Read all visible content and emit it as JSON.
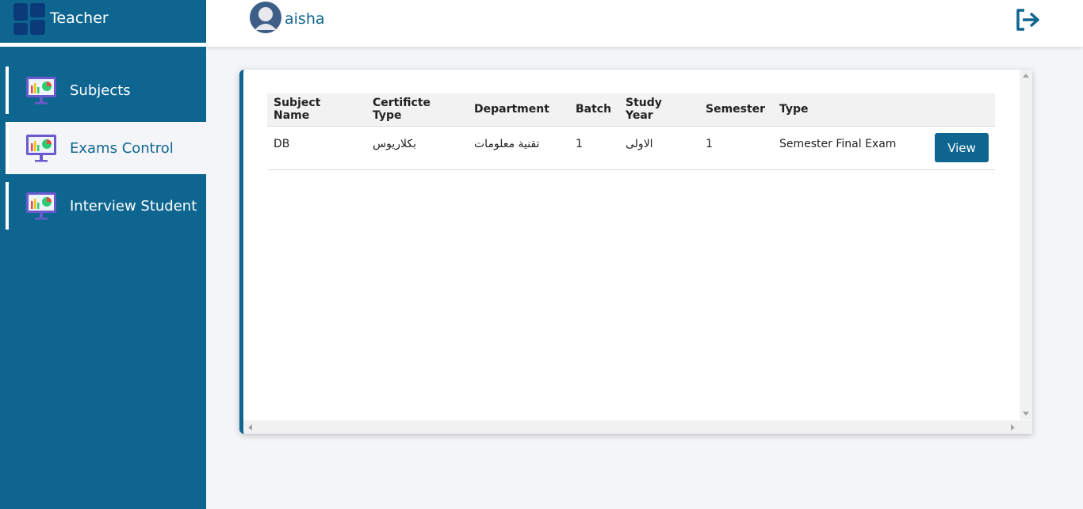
{
  "sidebar": {
    "brand_title": "Teacher",
    "items": [
      {
        "label": "Subjects",
        "icon": "presentation-chart-icon",
        "active": false
      },
      {
        "label": "Exams Control",
        "icon": "presentation-chart-icon",
        "active": true
      },
      {
        "label": "Interview Student",
        "icon": "presentation-chart-icon",
        "active": false
      }
    ]
  },
  "header": {
    "username": "aisha",
    "avatar_icon": "user-avatar-icon",
    "logout_icon": "logout-icon"
  },
  "table": {
    "columns": [
      "Subject Name",
      "Certificte Type",
      "Department",
      "Batch",
      "Study Year",
      "Semester",
      "Type",
      ""
    ],
    "rows": [
      {
        "subject_name": "DB",
        "certificate_type": "بكلاريوس",
        "department": "تقنية معلومات",
        "batch": "1",
        "study_year": "الاولى",
        "semester": "1",
        "type": "Semester Final Exam",
        "action": "View"
      }
    ]
  },
  "colors": {
    "primary": "#0e6690",
    "background": "#f4f5f9",
    "logo_dark": "#0a3a78"
  }
}
